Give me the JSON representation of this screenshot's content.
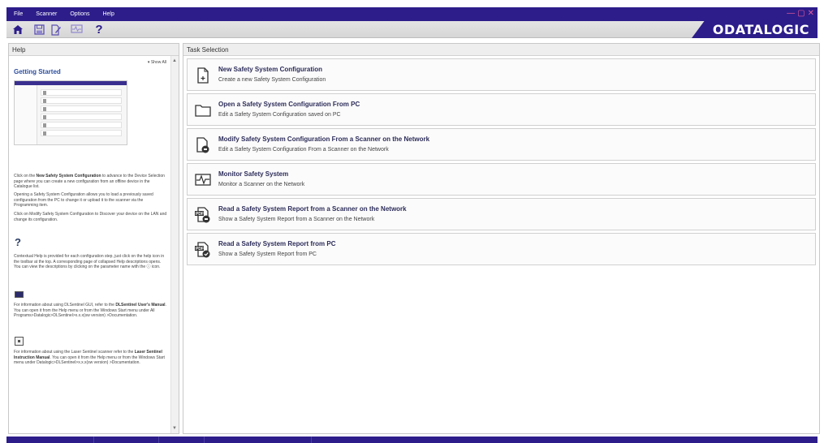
{
  "menu": {
    "items": [
      "File",
      "Scanner",
      "Options",
      "Help"
    ],
    "window_controls": [
      "—",
      "▢",
      "✕"
    ]
  },
  "toolbar": {
    "buttons": [
      "home-icon",
      "save-icon",
      "edit-document-icon",
      "monitor-icon",
      "help-icon"
    ],
    "help_glyph": "?",
    "logo_text": "ODATALOGIC"
  },
  "help": {
    "title": "Help",
    "show_all": "▾ Show All",
    "getting_started": "Getting Started",
    "paragraphs": {
      "p1_pre": "Click on the ",
      "p1_bold": "New Safety System Configuration",
      "p1_post": " to advance to the Device Selection page where you can create a new configuration from an offline device in the Catalogue list.",
      "p2": "Opening a Safety System Configuration allows you to load a previously saved configuration from the PC to change it or upload it to the scanner via the Programming item.",
      "p3": "Click on Modify Safety System Configuration to Discover your device on the LAN and change its configuration.",
      "p4": "Contextual Help is provided for each configuration step, just click on the help icon in the toolbar at the top. A corresponding page of collapsed Help descriptions opens. You can view the descriptions by clicking on the parameter name with the ⓘ icon.",
      "p5_pre": "For information about using DLSentinel GUI, refer to the ",
      "p5_bold": "DLSentinel User's Manual",
      "p5_post": ". You can open it from the Help menu or from the Windows Start menu under All Programs>Datalogic>DLSentinel>x.x.x(sw version) >Documentation.",
      "p6_pre": "For information about using the Laser Sentinel scanner refer to the ",
      "p6_bold": "Laser Sentinel Instruction Manual",
      "p6_post": ". You can open it from the Help menu or from the Windows Start menu under Datalogic>DLSentinel>x.x.x(sw version) >Documentation."
    },
    "q_glyph": "?"
  },
  "tasks": {
    "title": "Task Selection",
    "items": [
      {
        "icon": "new-document-icon",
        "title": "New Safety System Configuration",
        "desc": "Create a new Safety System Configuration"
      },
      {
        "icon": "folder-icon",
        "title": "Open a Safety System Configuration From PC",
        "desc": "Edit a Safety System Configuration saved on PC"
      },
      {
        "icon": "scanner-document-icon",
        "title": "Modify Safety System Configuration From a Scanner on the Network",
        "desc": "Edit a Safety System Configuration From a Scanner on the Network"
      },
      {
        "icon": "monitor-waveform-icon",
        "title": "Monitor Safety System",
        "desc": "Monitor a Scanner on the Network"
      },
      {
        "icon": "pdf-scanner-icon",
        "title": "Read a Safety System Report from a Scanner on the Network",
        "desc": "Show a Safety System Report from a Scanner on the Network"
      },
      {
        "icon": "pdf-pc-icon",
        "title": "Read a Safety System Report from PC",
        "desc": "Show a Safety System Report from PC"
      }
    ]
  },
  "colors": {
    "brand": "#2c1d8a",
    "window_control": "#e85a9a",
    "task_title": "#2c2c5a",
    "help_heading": "#2e4f9e"
  }
}
